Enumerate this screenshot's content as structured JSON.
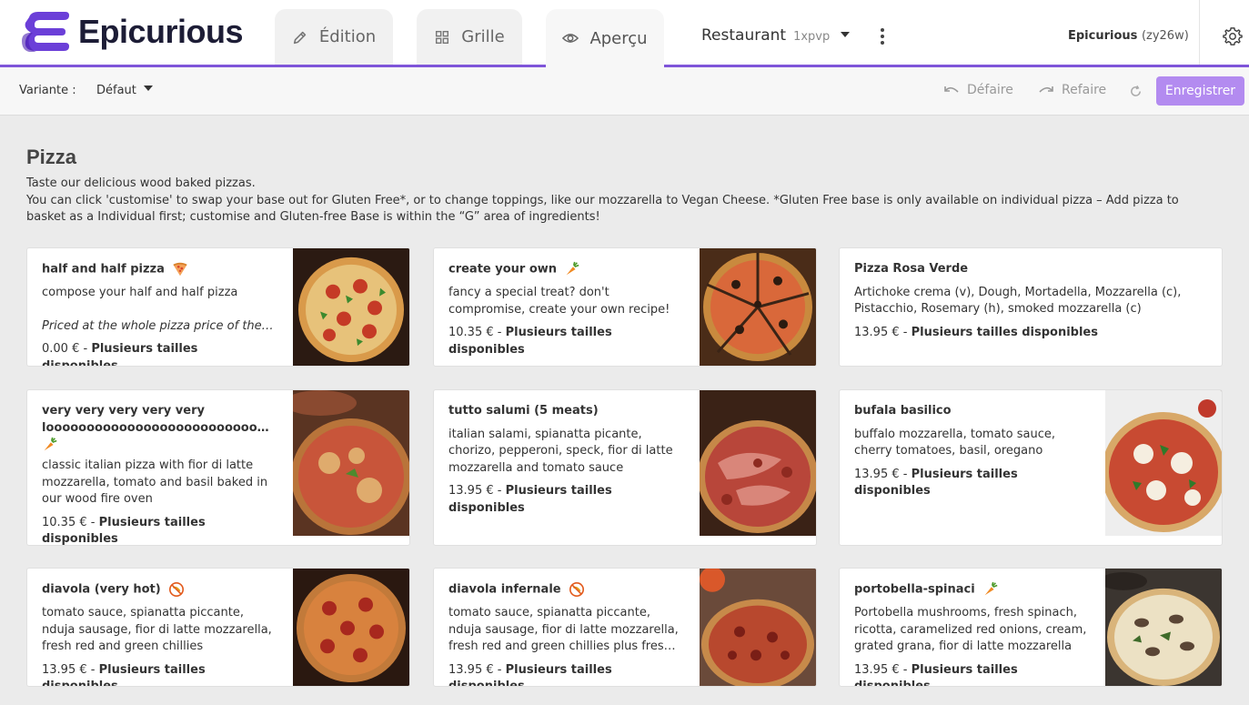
{
  "header": {
    "brand": "Epicurious",
    "tabs": [
      {
        "label": "Édition",
        "icon": "pencil-icon"
      },
      {
        "label": "Grille",
        "icon": "grid-icon"
      },
      {
        "label": "Aperçu",
        "icon": "eye-icon",
        "active": true
      }
    ],
    "restaurant_label": "Restaurant",
    "restaurant_code": "1xpvp",
    "account_name": "Epicurious",
    "account_id": "(zy26w)",
    "accent_color": "#7f55d9"
  },
  "toolbar": {
    "variant_label": "Variante :",
    "variant_value": "Défaut",
    "undo_label": "Défaire",
    "redo_label": "Refaire",
    "save_label": "Enregistrer"
  },
  "section": {
    "title": "Pizza",
    "desc_line1": "Taste our delicious wood baked pizzas.",
    "desc_line2": "You can click 'customise' to swap your base out for Gluten Free*, or to change toppings, like our mozzarella to Vegan Cheese. *Gluten Free base is only available on individual pizza – Add pizza to basket as a Individual first; customise and Gluten-free Base is within the “G” area of ingredients!"
  },
  "items": [
    {
      "name": "half and half pizza",
      "tag": "pizza-slice-icon",
      "desc": "compose your half and half pizza",
      "note": "Priced at the whole pizza price of the…",
      "price": "0.00 €",
      "sizes": "Plusieurs tailles disponibles"
    },
    {
      "name": "create your own",
      "tag": "carrot-icon",
      "desc": "fancy a special treat? don't compromise, create your own recipe!",
      "price": "10.35 €",
      "sizes": "Plusieurs tailles disponibles"
    },
    {
      "name": "Pizza Rosa Verde",
      "desc": "Artichoke crema (v), Dough, Mortadella, Mozzarella (c), Pistacchio, Rosemary (h), smoked mozzarella (c)",
      "price": "13.95 €",
      "sizes": "Plusieurs tailles disponibles"
    },
    {
      "name": "very very very very very looooooooooooooooooooooooooong…",
      "tag": "carrot-icon",
      "desc": "classic italian pizza with fior di latte mozzarella, tomato and basil baked in our wood fire oven",
      "price": "10.35 €",
      "sizes": "Plusieurs tailles disponibles"
    },
    {
      "name": "tutto salumi (5 meats)",
      "desc": "italian salami, spianatta picante, chorizo, pepperoni, speck, fior di latte mozzarella and tomato sauce",
      "price": "13.95 €",
      "sizes": "Plusieurs tailles disponibles"
    },
    {
      "name": "bufala basilico",
      "desc": "buffalo mozzarella, tomato sauce, cherry tomatoes, basil, oregano",
      "price": "13.95 €",
      "sizes": "Plusieurs tailles disponibles"
    },
    {
      "name": "diavola (very hot)",
      "tag": "no-chili-icon",
      "desc": "tomato sauce, spianatta piccante, nduja sausage, fior di latte mozzarella, fresh red and green chillies",
      "price": "13.95 €",
      "sizes": "Plusieurs tailles disponibles"
    },
    {
      "name": "diavola infernale",
      "tag": "no-chili-icon",
      "desc": "tomato sauce, spianatta piccante, nduja sausage, fior di latte mozzarella, fresh red and green chillies plus fresh scotch…",
      "price": "13.95 €",
      "sizes": "Plusieurs tailles disponibles"
    },
    {
      "name": "portobella-spinaci",
      "tag": "carrot-icon",
      "desc": "Portobella mushrooms, fresh spinach, ricotta, caramelized red onions, cream, grated grana, fior di latte mozzarella",
      "price": "13.95 €",
      "sizes": "Plusieurs tailles disponibles"
    }
  ]
}
